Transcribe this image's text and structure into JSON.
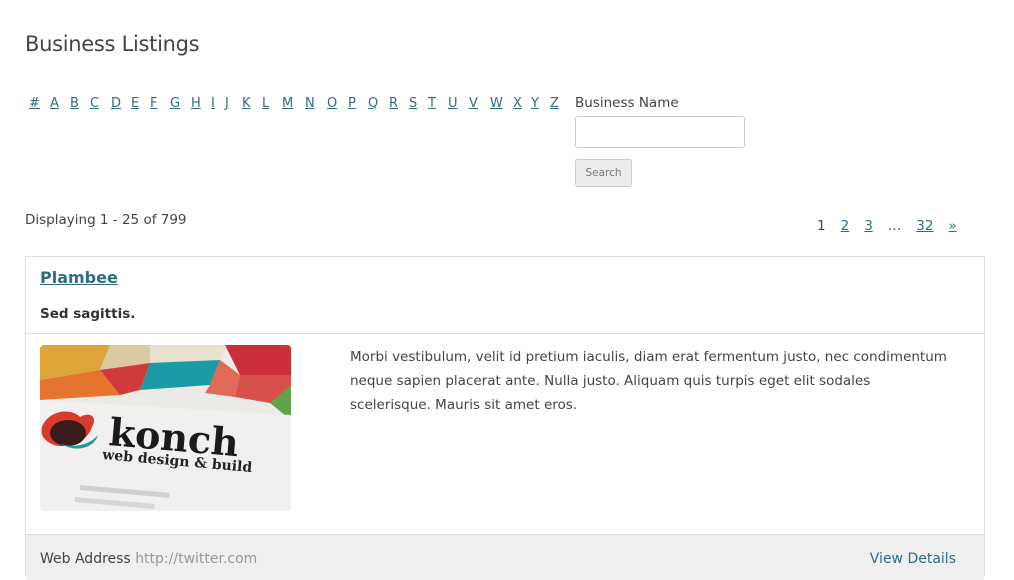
{
  "page": {
    "title": "Business Listings"
  },
  "alpha_filter": [
    "#",
    "A",
    "B",
    "C",
    "D",
    "E",
    "F",
    "G",
    "H",
    "I",
    "J",
    "K",
    "L",
    "M",
    "N",
    "O",
    "P",
    "Q",
    "R",
    "S",
    "T",
    "U",
    "V",
    "W",
    "X",
    "Y",
    "Z"
  ],
  "search": {
    "label": "Business Name",
    "value": "",
    "placeholder": "",
    "button_label": "Search"
  },
  "results": {
    "summary": "Displaying 1 - 25 of 799"
  },
  "pagination": {
    "current": "1",
    "pages": [
      "2",
      "3"
    ],
    "ellipsis": "…",
    "last": "32",
    "next": "»"
  },
  "listing": {
    "name": "Plambee",
    "tagline": "Sed sagittis.",
    "description": "Morbi vestibulum, velit id pretium iaculis, diam erat fermentum justo, nec condimentum neque sapien placerat ante. Nulla justo. Aliquam quis turpis eget elit sodales scelerisque. Mauris sit amet eros.",
    "image": {
      "brand_text": "konch",
      "sub_text": "web design & build",
      "alt": "konch business card"
    },
    "web_address_label": "Web Address",
    "web_address": "http://twitter.com",
    "view_details_label": "View Details"
  }
}
